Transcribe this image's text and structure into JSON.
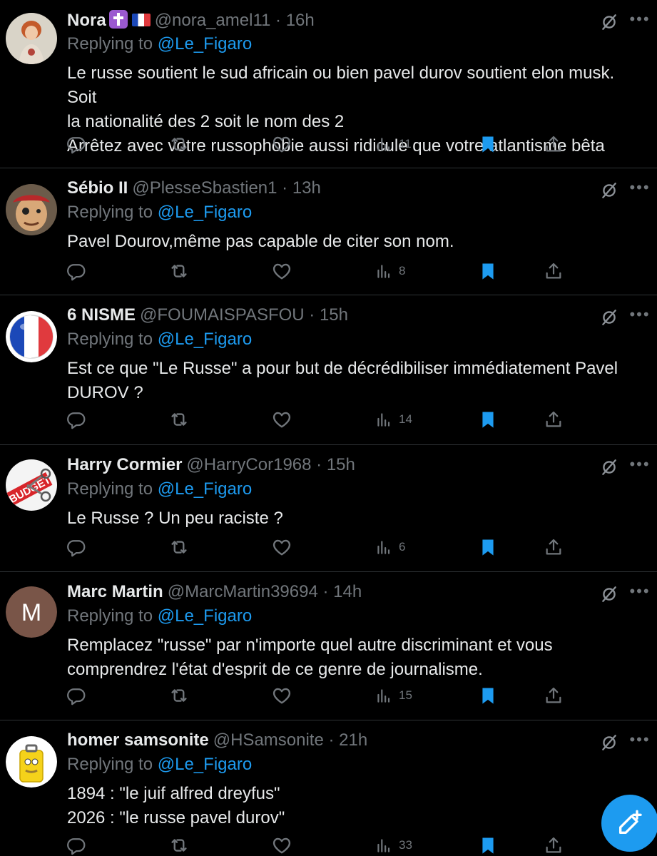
{
  "replying_prefix": "Replying to ",
  "replying_to": "@Le_Figaro",
  "fab_label": "New post",
  "colors": {
    "background": "#000000",
    "accent": "#1d9bf0",
    "muted": "#71767b",
    "text": "#e7e9ea"
  },
  "icons": {
    "reply": "reply-icon",
    "retweet": "retweet-icon",
    "like": "heart-icon",
    "views": "views-icon",
    "bookmark": "bookmark-icon",
    "share": "share-icon",
    "grok": "grok-icon",
    "more": "more-icon",
    "compose": "compose-icon"
  },
  "tweets": [
    {
      "name": "Nora",
      "handle": "@nora_amel11",
      "time": "16h",
      "meta": "@nora_amel11 · 16h",
      "emoji": [
        "latin-cross-emoji",
        "french-flag-emoji"
      ],
      "text_lines": [
        "Le russe soutient le sud africain ou bien pavel durov soutient elon musk. Soit",
        "la nationalité des 2 soit le nom des 2",
        "Arrêtez avec votre russophobie aussi ridicule que votre atlantisme bêta"
      ],
      "views": "11",
      "avatar": "portrait-painting"
    },
    {
      "name": "Sébio II",
      "handle": "@PlesseSbastien1",
      "time": "13h",
      "meta": "@PlesseSbastien1 · 13h",
      "text_lines": [
        "Pavel Dourov,même pas capable de citer son nom."
      ],
      "views": "8",
      "avatar": "pirate-face"
    },
    {
      "name": "6 NISME",
      "handle": "@FOUMAISPASFOU",
      "time": "15h",
      "meta": "@FOUMAISPASFOU · 15h",
      "text_lines": [
        "Est ce que \"Le Russe\" a pour but de décrédibiliser immédiatement Pavel",
        "DUROV ?"
      ],
      "views": "14",
      "avatar": "french-flag-ball"
    },
    {
      "name": "Harry Cormier",
      "handle": "@HarryCor1968",
      "time": "15h",
      "meta": "@HarryCor1968 · 15h",
      "text_lines": [
        "Le Russe ? Un peu raciste ?"
      ],
      "views": "6",
      "avatar": "budget-scissors",
      "avatar_text": "BUDGET"
    },
    {
      "name": "Marc Martin",
      "handle": "@MarcMartin39694",
      "time": "14h",
      "meta": "@MarcMartin39694 · 14h",
      "text_lines": [
        "Remplacez \"russe\" par n'importe quel autre discriminant et vous",
        "comprendrez l'état d'esprit de ce genre de journalisme."
      ],
      "views": "15",
      "avatar": "initial",
      "avatar_text": "M"
    },
    {
      "name": "homer samsonite",
      "handle": "@HSamsonite",
      "time": "21h",
      "meta": "@HSamsonite · 21h",
      "text_lines": [
        "1894 : \"le juif alfred dreyfus\"",
        "2026 : \"le russe pavel durov\""
      ],
      "views": "33",
      "avatar": "yellow-suitcase"
    }
  ]
}
